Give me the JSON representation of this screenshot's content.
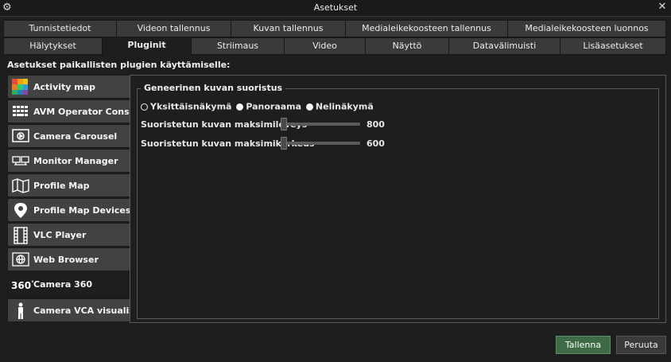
{
  "window": {
    "title": "Asetukset",
    "close_glyph": "✕"
  },
  "tabs_row1": [
    {
      "label": "Tunnistetiedot"
    },
    {
      "label": "Videon tallennus"
    },
    {
      "label": "Kuvan tallennus"
    },
    {
      "label": "Medialeikekoosteen tallennus"
    },
    {
      "label": "Medialeikekoosteen luonnos"
    }
  ],
  "tabs_row2": [
    {
      "label": "Hälytykset"
    },
    {
      "label": "Pluginit",
      "active": true
    },
    {
      "label": "Striimaus"
    },
    {
      "label": "Video"
    },
    {
      "label": "Näyttö"
    },
    {
      "label": "Datavälimuisti"
    },
    {
      "label": "Lisäasetukset"
    }
  ],
  "plugins": {
    "heading": "Asetukset paikallisten plugien käyttämiselle:",
    "items": [
      {
        "label": "Activity map",
        "icon": "activity-map-icon"
      },
      {
        "label": "AVM Operator Console",
        "icon": "keyboard-grid-icon"
      },
      {
        "label": "Camera Carousel",
        "icon": "carousel-icon"
      },
      {
        "label": "Monitor Manager",
        "icon": "monitors-icon"
      },
      {
        "label": "Profile Map",
        "icon": "map-icon"
      },
      {
        "label": "Profile Map Devices",
        "icon": "map-pin-icon"
      },
      {
        "label": "VLC Player",
        "icon": "film-icon"
      },
      {
        "label": "Web Browser",
        "icon": "globe-icon"
      },
      {
        "label": "Camera 360",
        "icon": "camera-360-icon",
        "selected": true
      },
      {
        "label": "Camera VCA visualization",
        "icon": "person-icon"
      }
    ]
  },
  "settings": {
    "group_title": "Geneerinen kuvan suoristus",
    "view_modes": [
      {
        "label": "Yksittäisnäkymä",
        "checked": false
      },
      {
        "label": "Panoraama",
        "checked": true
      },
      {
        "label": "Nelinäkymä",
        "checked": true
      }
    ],
    "max_width": {
      "label": "Suoristetun kuvan maksimileveys",
      "value": "800"
    },
    "max_height": {
      "label": "Suoristetun kuvan maksimikorkeus",
      "value": "600"
    },
    "slider_fraction": 0.0
  },
  "buttons": {
    "save": "Tallenna",
    "cancel": "Peruuta"
  },
  "colors": {
    "save_button": "#3e6b46"
  }
}
